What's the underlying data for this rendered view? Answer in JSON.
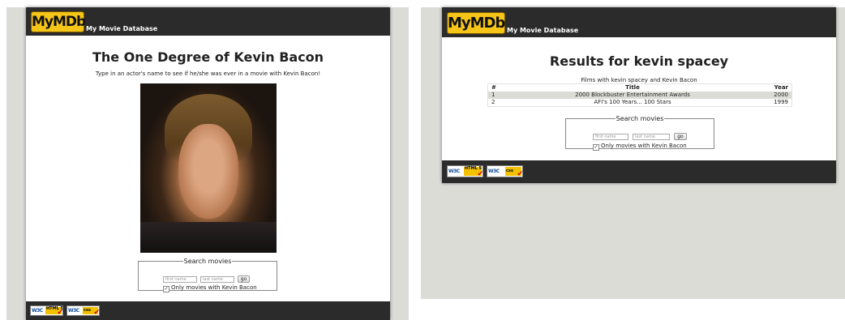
{
  "brand": {
    "logo_text": "MyMDb",
    "tagline": "My Movie Database"
  },
  "left_page": {
    "title": "The One Degree of Kevin Bacon",
    "instructions": "Type in an actor's name to see if he/she was ever in a movie with Kevin Bacon!",
    "photo_alt": "Kevin Bacon"
  },
  "right_page": {
    "title": "Results for kevin spacey",
    "caption": "Films with kevin spacey and Kevin Bacon",
    "columns": [
      "#",
      "Title",
      "Year"
    ],
    "rows": [
      {
        "num": "1",
        "title": "2000 Blockbuster Entertainment Awards",
        "year": "2000"
      },
      {
        "num": "2",
        "title": "AFI's 100 Years... 100 Stars",
        "year": "1999"
      }
    ]
  },
  "search": {
    "legend": "Search movies",
    "first_placeholder": "first name",
    "last_placeholder": "last name",
    "go_label": "go",
    "checkbox_label": "Only movies with Kevin Bacon",
    "checked": true
  },
  "badges": {
    "w3c": "W3C",
    "html": "HTML 5",
    "css": "css"
  },
  "colors": {
    "header": "#2b2b2b",
    "background": "#dcdcd7",
    "logo": "#f5c518"
  }
}
